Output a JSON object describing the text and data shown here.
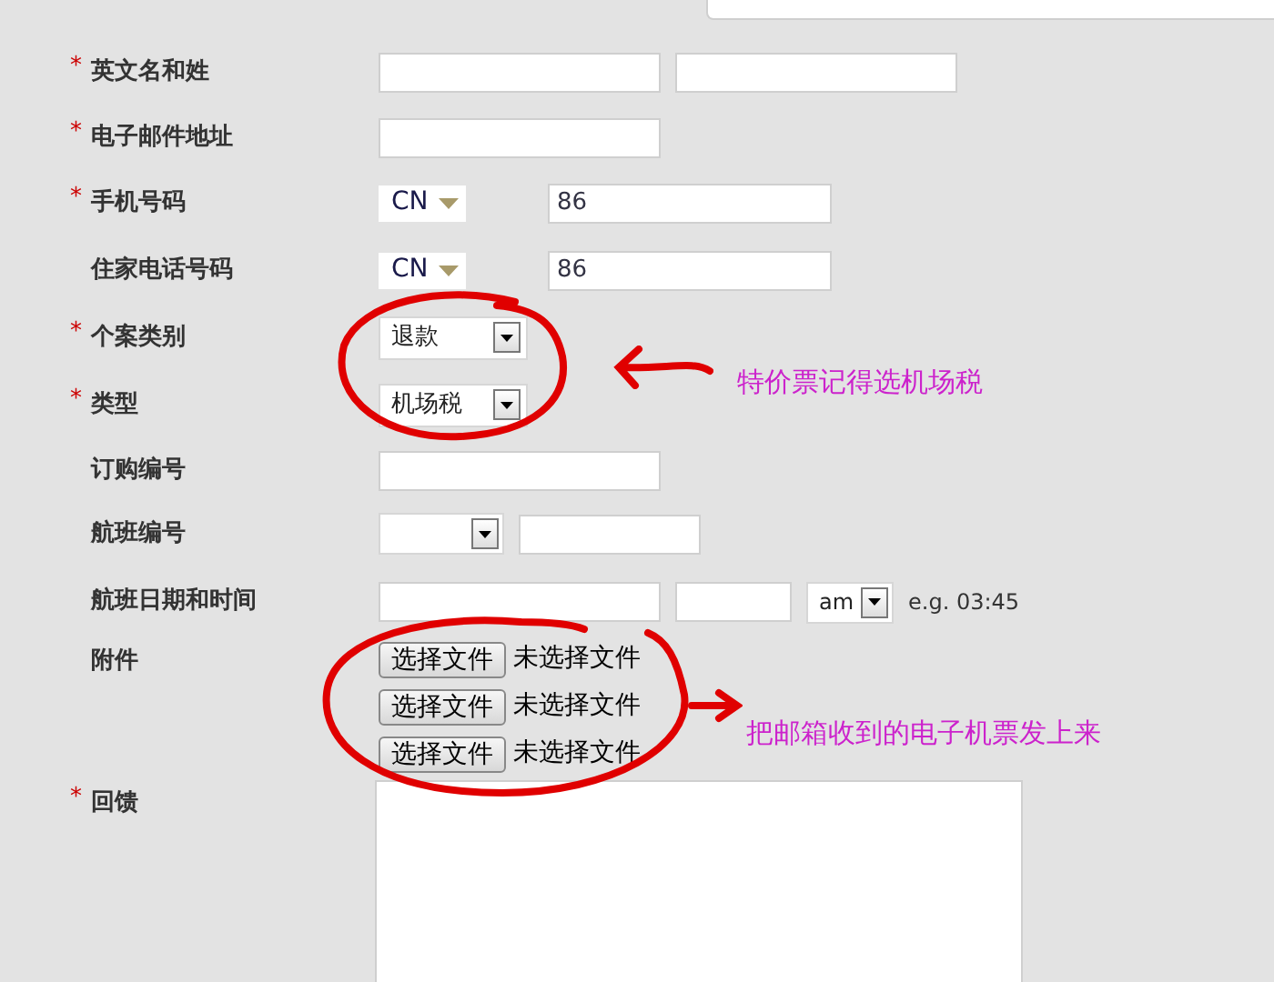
{
  "fields": [
    {
      "kind": "text_pair",
      "mark": "*",
      "label": "英文名和姓"
    },
    {
      "kind": "text",
      "mark": "*",
      "label": "电子邮件地址"
    },
    {
      "kind": "phone",
      "mark": "*",
      "label": "手机号码",
      "country": "CN",
      "value": "86"
    },
    {
      "kind": "phone",
      "label": "住家电话号码",
      "country": "CN",
      "value": "86"
    },
    {
      "kind": "select",
      "mark": "*",
      "label": "个案类别",
      "value": "退款"
    },
    {
      "kind": "select",
      "mark": "*",
      "label": "类型",
      "value": "机场税"
    },
    {
      "kind": "text",
      "label": "订购编号"
    },
    {
      "kind": "select_text",
      "label": "航班编号"
    },
    {
      "kind": "datetime",
      "label": "航班日期和时间",
      "meridiem": "am",
      "hint": "e.g. 03:45"
    },
    {
      "kind": "files",
      "label": "附件",
      "files": [
        {
          "button": "选择文件",
          "status": "未选择文件"
        },
        {
          "button": "选择文件",
          "status": "未选择文件"
        },
        {
          "button": "选择文件",
          "status": "未选择文件"
        }
      ]
    },
    {
      "kind": "textarea",
      "mark": "*",
      "label": "回馈"
    }
  ],
  "annotations": [
    {
      "text": "特价票记得选机场税"
    },
    {
      "text": "把邮箱收到的电子机票发上来"
    }
  ]
}
